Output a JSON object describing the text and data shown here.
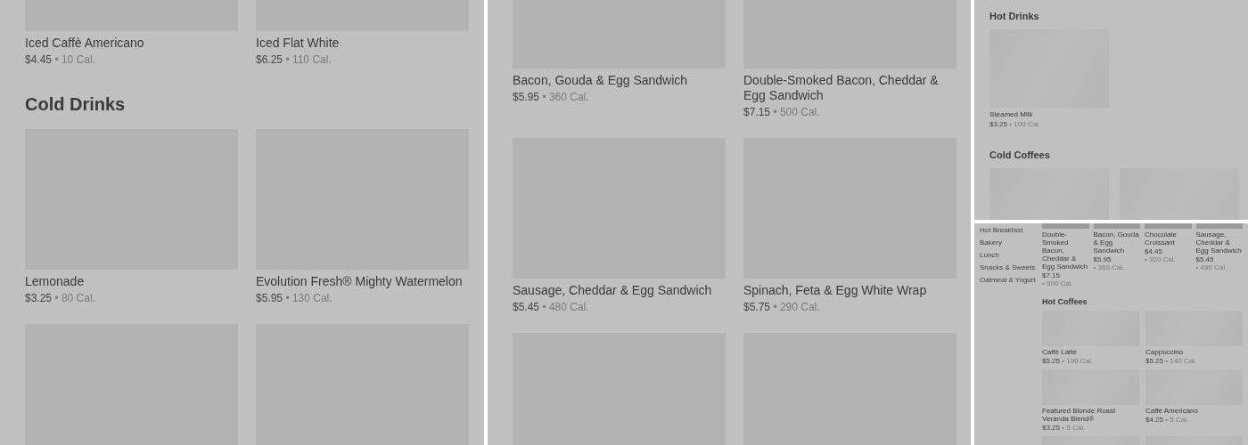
{
  "panels": [
    {
      "kind": "large",
      "sections": [
        {
          "items": [
            {
              "kind": "product",
              "name": "Iced Caffè Americano",
              "price": "$4.45",
              "calories": "• 10 Cal."
            },
            {
              "kind": "product",
              "name": "Iced Flat White",
              "price": "$6.25",
              "calories": "• 110 Cal."
            }
          ]
        },
        {
          "title": "Cold Drinks",
          "items": [
            {
              "kind": "product",
              "name": "Lemonade",
              "price": "$3.25",
              "calories": "• 80 Cal."
            },
            {
              "kind": "product",
              "name": "Evolution Fresh® Mighty Watermelon",
              "price": "$5.95",
              "calories": "• 130 Cal."
            },
            {
              "kind": "image"
            },
            {
              "kind": "image"
            }
          ]
        }
      ]
    },
    {
      "kind": "large",
      "sections": [
        {
          "items": [
            {
              "kind": "product",
              "name": "Bacon, Gouda & Egg Sandwich",
              "price": "$5.95",
              "calories": "• 360 Cal."
            },
            {
              "kind": "product",
              "name": "Double-Smoked Bacon, Cheddar & Egg Sandwich",
              "price": "$7.15",
              "calories": "• 500 Cal."
            },
            {
              "kind": "product",
              "name": "Sausage, Cheddar & Egg Sandwich",
              "price": "$5.45",
              "calories": "• 480 Cal."
            },
            {
              "kind": "product",
              "name": "Spinach, Feta & Egg White Wrap",
              "price": "$5.75",
              "calories": "• 290 Cal."
            },
            {
              "kind": "image"
            },
            {
              "kind": "image"
            }
          ]
        }
      ]
    },
    {
      "kind": "small",
      "sections": [
        {
          "title": "Hot Drinks",
          "items": [
            {
              "kind": "product",
              "name": "Steamed Milk",
              "price": "$3.25",
              "calories": "• 100 Cal."
            }
          ]
        },
        {
          "title": "Cold Coffees",
          "items": [
            {
              "kind": "image"
            },
            {
              "kind": "image"
            }
          ]
        }
      ]
    },
    {
      "kind": "tiny",
      "sidebar": [
        "Hot Breakfast",
        "Bakery",
        "Lunch",
        "Snacks & Sweets",
        "Oatmeal & Yogurt"
      ],
      "sections": [
        {
          "items": [
            {
              "kind": "product",
              "name": "Double-Smoked Bacon, Cheddar & Egg Sandwich",
              "price": "$7.15",
              "calories": "• 500 Cal."
            },
            {
              "kind": "product",
              "name": "Bacon, Gouda & Egg Sandwich",
              "price": "$5.95",
              "calories": "• 360 Cal."
            },
            {
              "kind": "product",
              "name": "Chocolate Croissant",
              "price": "$4.45",
              "calories": "• 320 Cal."
            },
            {
              "kind": "product",
              "name": "Sausage, Cheddar & Egg Sandwich",
              "price": "$5.45",
              "calories": "• 480 Cal."
            }
          ]
        },
        {
          "title": "Hot Coffees",
          "items": [
            {
              "kind": "product",
              "name": "Caffè Latte",
              "price": "$5.25",
              "calories": "• 190 Cal."
            },
            {
              "kind": "product",
              "name": "Cappuccino",
              "price": "$5.25",
              "calories": "• 140 Cal."
            },
            {
              "kind": "product",
              "name": "Featured Blonde Roast Veranda Blend®",
              "price": "$3.25",
              "calories": "• 5 Cal."
            },
            {
              "kind": "product",
              "name": "Caffè Americano",
              "price": "$4.25",
              "calories": "• 5 Cal."
            },
            {
              "kind": "image"
            },
            {
              "kind": "image"
            }
          ]
        }
      ]
    }
  ]
}
